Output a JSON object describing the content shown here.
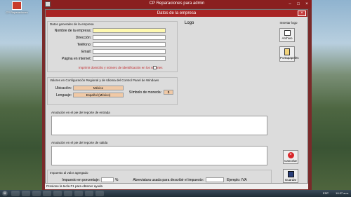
{
  "desktop": {
    "icon_label": "CP Reparaciones"
  },
  "app": {
    "title": "CP Reparaciones para admin"
  },
  "dialog": {
    "title": "Datos de la empresa",
    "general": {
      "group_title": "Datos generales de la empresa",
      "name_label": "Nombre de la empresa:",
      "name_value": "",
      "address_label": "Dirección:",
      "address_value": "",
      "phone_label": "Teléfono:",
      "phone_value": "",
      "email_label": "Email:",
      "email_value": "",
      "web_label": "Página en internet:",
      "web_value": "",
      "print_checkbox_label": "Imprimir domicilio y número de identificación en los reportes"
    },
    "logo": {
      "label": "Logo"
    },
    "insert_logo": {
      "title": "Insertar logo",
      "file_button": "Archivo",
      "clipboard_button": "Portapapeles"
    },
    "regional": {
      "group_title": "Valores en Configuración Regional y de Idioma del Control Panel de Windows",
      "location_label": "Ubicación:",
      "location_value": "México",
      "language_label": "Lenguaje:",
      "language_value": "Español (México)",
      "currency_label": "Símbolo de moneda:",
      "currency_value": "$"
    },
    "entry_note": {
      "label": "Anotación en el pie del reporte de entrada",
      "value": ""
    },
    "exit_note": {
      "label": "Anotación en el pie del reporte de salida",
      "value": ""
    },
    "tax": {
      "group_title": "Impuesto al valor agregado",
      "percent_label": "Impuesto en porcentaje:",
      "percent_value": "",
      "percent_suffix": "%",
      "abbr_label": "Abreviatura usada para describir el impuesto:",
      "abbr_value": "",
      "example": "Ejemplo: IVA"
    },
    "buttons": {
      "cancel": "Cancelar",
      "save": "Guardar"
    }
  },
  "status_bar": {
    "text": "Presione la tecla F1 para obtener ayuda"
  },
  "taskbar": {
    "tray_lang": "ESP",
    "tray_time": "10:37 a.m."
  },
  "colors": {
    "titlebar": "#a82424",
    "dialog_bg": "#dcdcdc",
    "highlight_field": "#fff9b0",
    "readonly_field": "#f0c9a6"
  }
}
